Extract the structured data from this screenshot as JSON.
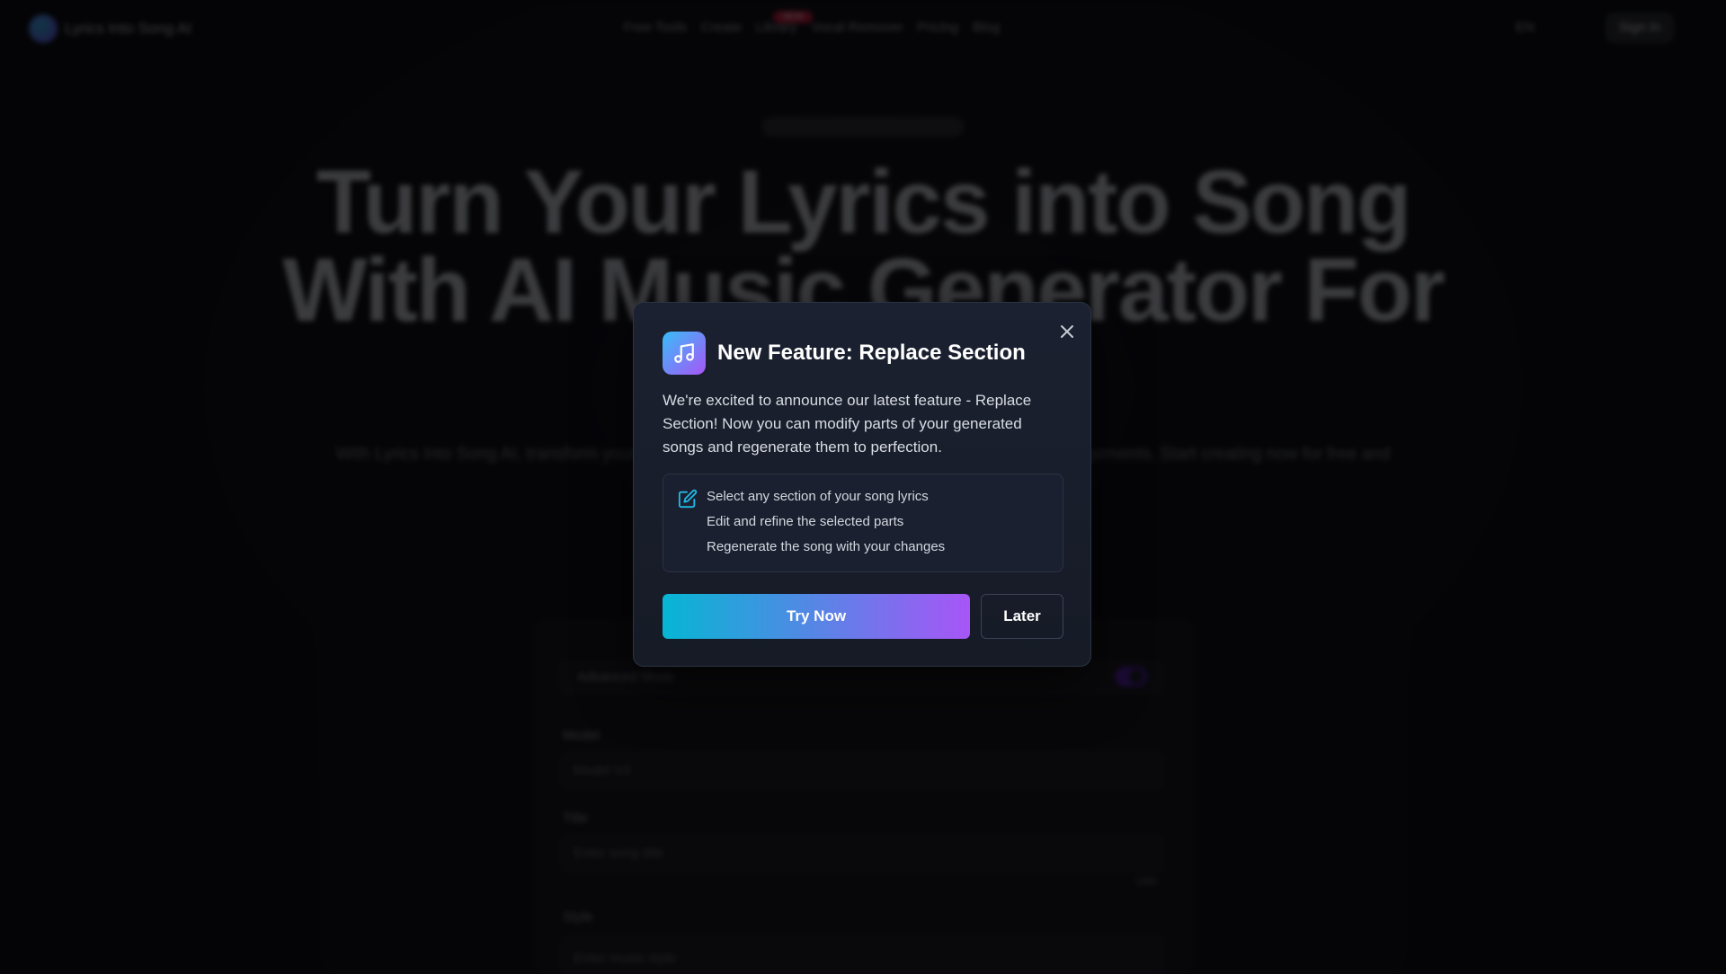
{
  "background_page": {
    "brand": "Lyrics Into Song AI",
    "nav_links": [
      "Free Tools",
      "Create",
      "Library",
      "Vocal Remover",
      "Pricing",
      "Blog"
    ],
    "new_badge": "NEW",
    "language": "EN",
    "sign_in": "Sign In",
    "hero_title_line1": "Turn Your Lyrics into Song",
    "hero_title_line2": "With AI Music Generator For",
    "hero_subtitle": "With Lyrics Into Song AI, transform your lyrics into complete songs with melodies, vocals, and arrangements. Start creating now for free and bring your words to life.",
    "form": {
      "advanced_mode_label": "Advanced Mode",
      "advanced_mode_on": true,
      "model_label": "Model",
      "model_value": "Model V3",
      "title_label": "Title",
      "title_placeholder": "Enter song title",
      "title_count": "0/80",
      "style_label": "Style",
      "style_placeholder": "Enter music style"
    }
  },
  "modal": {
    "title": "New Feature: Replace Section",
    "description": "We're excited to announce our latest feature - Replace Section! Now you can modify parts of your generated songs and regenerate them to perfection.",
    "features": [
      "Select any section of your song lyrics",
      "Edit and refine the selected parts",
      "Regenerate the song with your changes"
    ],
    "primary_button": "Try Now",
    "secondary_button": "Later",
    "icon": "music-note-icon",
    "feature_icon": "edit-icon",
    "gradient_start": "#06b6d4",
    "gradient_end": "#a855f7"
  }
}
